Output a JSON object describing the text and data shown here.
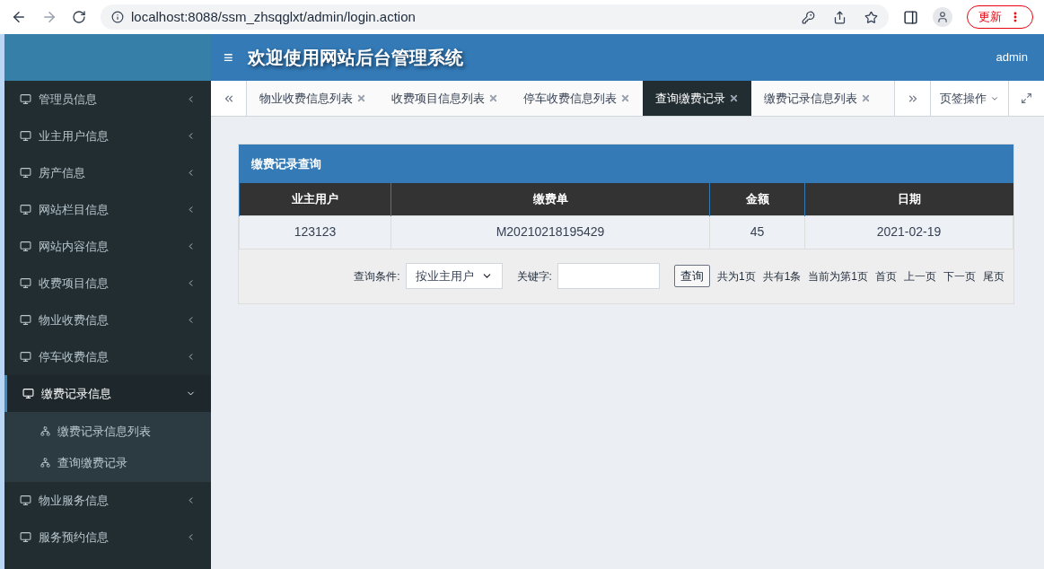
{
  "browser": {
    "url": "localhost:8088/ssm_zhsqglxt/admin/login.action",
    "update_button": "更新"
  },
  "header": {
    "menu_glyph": "≡",
    "title": "欢迎使用网站后台管理系统",
    "user": "admin"
  },
  "sidebar": {
    "items": [
      {
        "label": "管理员信息",
        "expanded": false
      },
      {
        "label": "业主用户信息",
        "expanded": false
      },
      {
        "label": "房产信息",
        "expanded": false
      },
      {
        "label": "网站栏目信息",
        "expanded": false
      },
      {
        "label": "网站内容信息",
        "expanded": false
      },
      {
        "label": "收费项目信息",
        "expanded": false
      },
      {
        "label": "物业收费信息",
        "expanded": false
      },
      {
        "label": "停车收费信息",
        "expanded": false
      },
      {
        "label": "缴费记录信息",
        "expanded": true,
        "children": [
          {
            "label": "缴费记录信息列表"
          },
          {
            "label": "查询缴费记录"
          }
        ]
      },
      {
        "label": "物业服务信息",
        "expanded": false
      },
      {
        "label": "服务预约信息",
        "expanded": false
      }
    ]
  },
  "tabs": [
    {
      "label": "物业收费信息列表",
      "selected": false
    },
    {
      "label": "收费项目信息列表",
      "selected": false
    },
    {
      "label": "停车收费信息列表",
      "selected": false
    },
    {
      "label": "查询缴费记录",
      "selected": true
    },
    {
      "label": "缴费记录信息列表",
      "selected": false
    }
  ],
  "tab_actions": "页签操作",
  "panel": {
    "title": "缴费记录查询",
    "table": {
      "columns": [
        "业主用户",
        "缴费单",
        "金额",
        "日期"
      ],
      "rows": [
        [
          "123123",
          "M20210218195429",
          "45",
          "2021-02-19"
        ]
      ]
    },
    "search": {
      "condition_label": "查询条件:",
      "condition_value": "按业主用户",
      "keyword_label": "关键字:",
      "button": "查询"
    },
    "pager": {
      "info": [
        "共为1页",
        "共有1条",
        "当前为第1页"
      ],
      "links": [
        "首页",
        "上一页",
        "下一页",
        "尾页"
      ]
    }
  }
}
